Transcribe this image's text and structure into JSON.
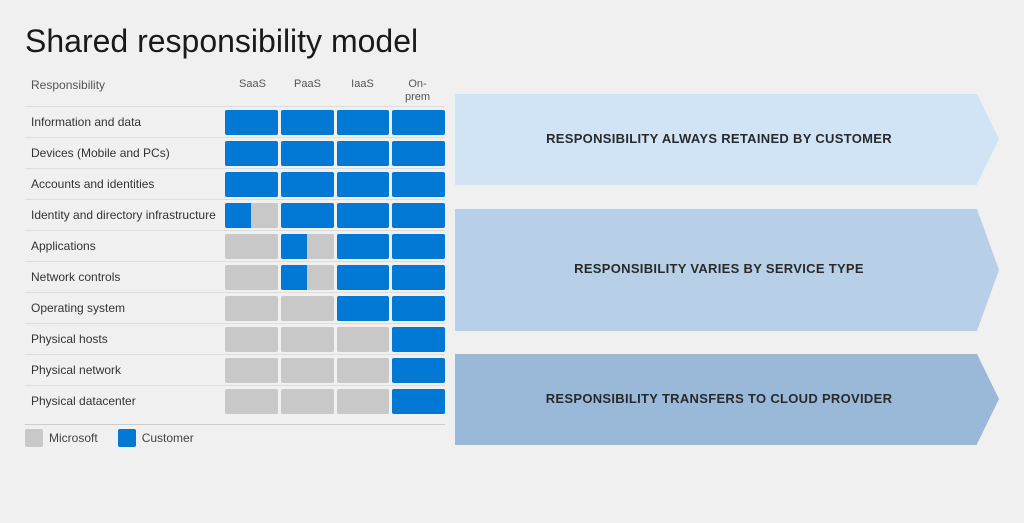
{
  "title": "Shared responsibility model",
  "columns": {
    "label": "Responsibility",
    "headers": [
      "SaaS",
      "PaaS",
      "IaaS",
      "On-\nprem"
    ]
  },
  "rows": [
    {
      "label": "Information and data",
      "cells": [
        "blue",
        "blue",
        "blue",
        "blue"
      ]
    },
    {
      "label": "Devices (Mobile and PCs)",
      "cells": [
        "blue",
        "blue",
        "blue",
        "blue"
      ]
    },
    {
      "label": "Accounts and identities",
      "cells": [
        "blue",
        "blue",
        "blue",
        "blue"
      ]
    },
    {
      "label": "Identity and directory infrastructure",
      "cells": [
        "half",
        "blue",
        "blue",
        "blue"
      ]
    },
    {
      "label": "Applications",
      "cells": [
        "gray",
        "half",
        "blue",
        "blue"
      ]
    },
    {
      "label": "Network controls",
      "cells": [
        "gray",
        "half",
        "blue",
        "blue"
      ]
    },
    {
      "label": "Operating system",
      "cells": [
        "gray",
        "gray",
        "blue",
        "blue"
      ]
    },
    {
      "label": "Physical hosts",
      "cells": [
        "gray",
        "gray",
        "gray",
        "blue"
      ]
    },
    {
      "label": "Physical network",
      "cells": [
        "gray",
        "gray",
        "gray",
        "blue"
      ]
    },
    {
      "label": "Physical datacenter",
      "cells": [
        "gray",
        "gray",
        "gray",
        "blue"
      ]
    }
  ],
  "arrows": [
    {
      "text": "RESPONSIBILITY ALWAYS RETAINED BY CUSTOMER",
      "rows_count": 3,
      "color_class": "arrow-top"
    },
    {
      "text": "RESPONSIBILITY VARIES BY SERVICE TYPE",
      "rows_count": 4,
      "color_class": "arrow-mid"
    },
    {
      "text": "RESPONSIBILITY TRANSFERS TO CLOUD PROVIDER",
      "rows_count": 3,
      "color_class": "arrow-bottom"
    }
  ],
  "legend": {
    "items": [
      {
        "color": "gray",
        "label": "Microsoft"
      },
      {
        "color": "blue",
        "label": "Customer"
      }
    ]
  }
}
